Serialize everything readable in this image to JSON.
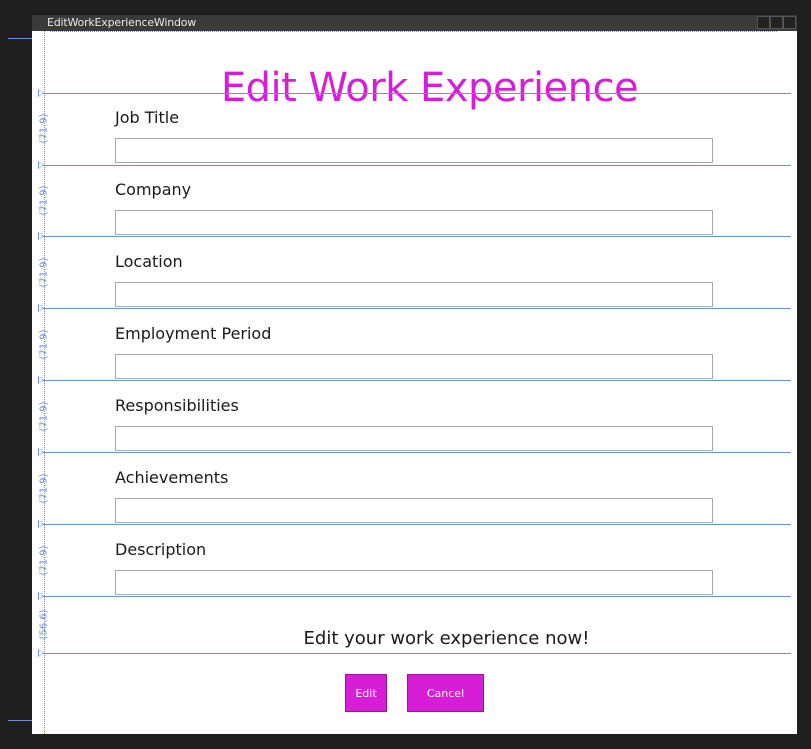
{
  "window": {
    "title": "EditWorkExperienceWindow"
  },
  "heading": "Edit Work Experience",
  "fields": [
    {
      "label": "Job Title",
      "value": "",
      "placeholder": ""
    },
    {
      "label": "Company",
      "value": "",
      "placeholder": ""
    },
    {
      "label": "Location",
      "value": "",
      "placeholder": ""
    },
    {
      "label": "Employment Period",
      "value": "",
      "placeholder": ""
    },
    {
      "label": "Responsibilities",
      "value": "",
      "placeholder": ""
    },
    {
      "label": "Achievements",
      "value": "",
      "placeholder": ""
    },
    {
      "label": "Description",
      "value": "",
      "placeholder": ""
    }
  ],
  "row_sizes": [
    "(71.9)",
    "(71.9)",
    "(71.9)",
    "(71.9)",
    "(71.9)",
    "(71.9)",
    "(71.9)",
    "(56.6)"
  ],
  "message": "Edit your work experience now!",
  "buttons": {
    "edit_label": "Edit",
    "cancel_label": "Cancel"
  },
  "colors": {
    "accent": "#d61ed6",
    "guide": "#6f8fd8",
    "window_bg": "#1f1f1f"
  }
}
